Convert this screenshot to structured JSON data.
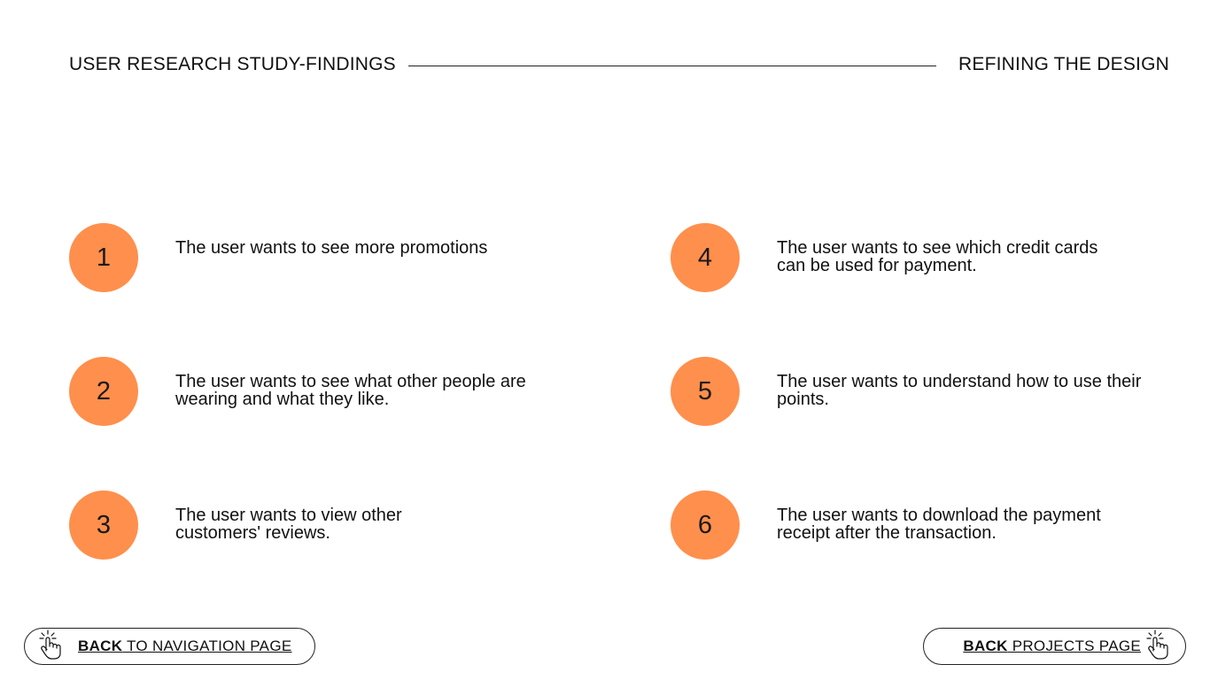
{
  "header": {
    "left_title": "USER RESEARCH STUDY-FINDINGS",
    "right_title": "REFINING THE DESIGN"
  },
  "findings": [
    {
      "number": "1",
      "text": "The user wants to see more promotions"
    },
    {
      "number": "2",
      "text": "The user wants to see what other people are wearing and what they like."
    },
    {
      "number": "3",
      "text": "The user wants to view other customers' reviews."
    },
    {
      "number": "4",
      "text": "The user wants to see which credit cards can be used for payment."
    },
    {
      "number": "5",
      "text": "The user wants to understand how to use their points."
    },
    {
      "number": "6",
      "text": "The user wants to download the payment receipt after the transaction."
    }
  ],
  "footer": {
    "back_nav": {
      "bold": "BACK",
      "rest": " TO NAVIGATION PAGE"
    },
    "back_projects": {
      "bold": "BACK",
      "rest": " PROJECTS PAGE"
    }
  },
  "colors": {
    "badge": "#ff8f4c",
    "text": "#111111",
    "background": "#ffffff"
  },
  "icons": {
    "button_icon": "pointer-hand-icon"
  }
}
